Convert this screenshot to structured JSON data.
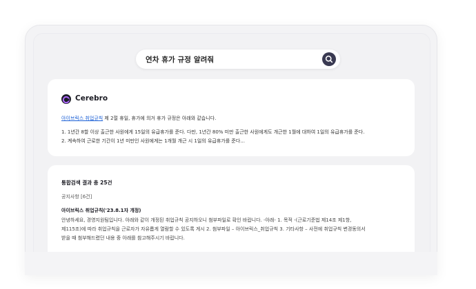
{
  "search": {
    "query": "연차 휴가 규정 알려줘"
  },
  "answer": {
    "brand": "Cerebro",
    "link_text": "아이브릭스 취업규칙",
    "intro_rest": " 제 2절 휴일, 휴가에 의거 휴가 규정은 아래와 같습니다.",
    "lines": [
      "1. 1년간 8할 이상 출근한 사원에게 15일의 유급휴가를 준다. 다만, 1년간 80% 미만 출근한 사원에게도 개근한 1월에 대하여 1일의 유급휴가를 준다.",
      "2. 계속하여 근로한 기간이 1년 미만인 사원에게는 1개월 개근 시 1일의 유급휴가를 준다..."
    ]
  },
  "results": {
    "title": "통합검색 결과 총 25건",
    "section": "공지사항 [6건]",
    "item_title": "아이브릭스 취업규칙('23.8.1자 개정)",
    "snippet_lines": [
      "안녕하세요, 경영지원팀입니다. 아래와 같이 개정된 취업규칙 공지하오니 첨부파일로 확인 바랍니다. -아래- 1. 목적 -(근로기준법 제14조 제1항,",
      "제115조)에 따라 취업규칙을 근로자가 자유롭게 열람할 수 있도록 게시 2. 첨부파일 – 아이브릭스_취업규칙 3. 기타사항 – 사전에 취업규칙 변경동의서",
      "받을 때 첨부해드렸던 내용 중 아래를 참고해주시기 바랍니다."
    ]
  },
  "icons": {
    "search_button": "search-icon",
    "brand_logo": "cerebro-logo-icon"
  },
  "colors": {
    "link": "#1a5fd6",
    "search_button_bg": "#3a3a52",
    "logo_bg": "#1d1d28"
  }
}
